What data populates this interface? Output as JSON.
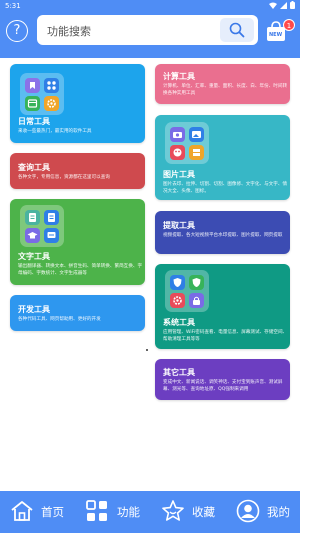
{
  "status_bar": {
    "time": "5:31"
  },
  "header": {
    "search_placeholder": "功能搜索",
    "store_badge_text": "NEW",
    "badge_count": "1"
  },
  "cards": {
    "daily": {
      "title": "日常工具",
      "desc": "来收一些最热门，最实用的软件工具"
    },
    "query": {
      "title": "查询工具",
      "desc": "各种文字，专用信息，资源都在这里可以查询"
    },
    "text": {
      "title": "文字工具",
      "desc": "输出翻译器、转换文本、拼音生码、简单转换、繁简互换、字母编码、字数统计、文字生成器等"
    },
    "dev": {
      "title": "开发工具",
      "desc": "各种代码工具、网页帮助用、更好的开发"
    },
    "calc": {
      "title": "计算工具",
      "desc": "计算机、单位、汇率、重量、面积、长度、白、年份、时间转换各种实用工具"
    },
    "image": {
      "title": "图片工具",
      "desc": "图片去印、拉伸、切割、切割、图像修、文字化、与文字、情况大全、头像、图标。"
    },
    "extract": {
      "title": "提取工具",
      "desc": "视频提取、各大短视频平台水印提取、图片提取、网页提取"
    },
    "system": {
      "title": "系统工具",
      "desc": "应用管理、WiFi密码查看、电量信息、屏幕测试、存储空间、帮助清理工具等等"
    },
    "other": {
      "title": "其它工具",
      "desc": "变成中文、新闻说话、调笑神话、支付宝到账声音、测试屏幕、测光等、查询地址原、QQ强制来调用"
    }
  },
  "colors": {
    "header": "#4f8df5",
    "daily": "#1da4ec",
    "query": "#cf4a4e",
    "text": "#4db34a",
    "dev": "#2e97ef",
    "calc": "#ea6f8f",
    "image": "#37b7c6",
    "extract": "#3c4cb3",
    "system": "#0f9a84",
    "other": "#6c3ec1"
  },
  "bottom_nav": {
    "home": "首页",
    "functions": "功能",
    "favorites": "收藏",
    "mine": "我的"
  }
}
